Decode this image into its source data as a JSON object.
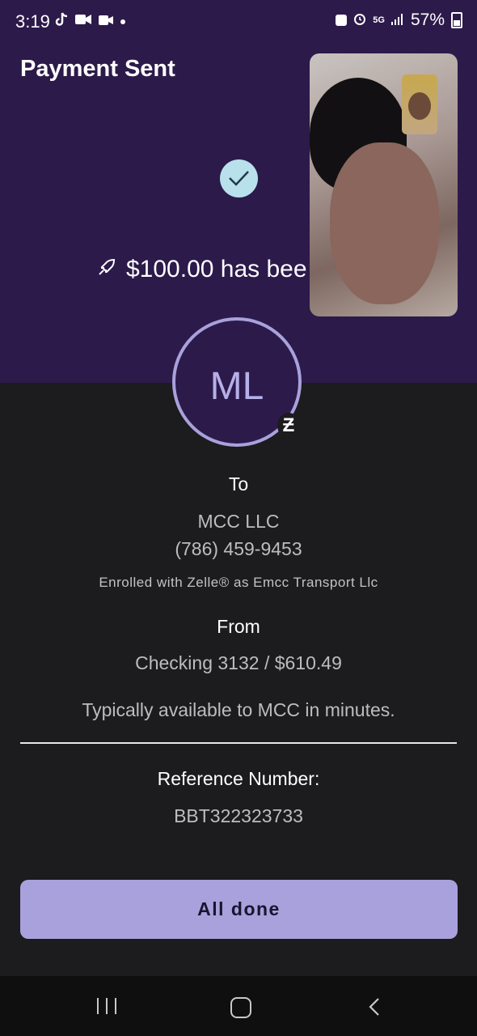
{
  "status_bar": {
    "time": "3:19",
    "battery": "57%",
    "network": "5G",
    "icons": [
      "tiktok-icon",
      "video-call-icon",
      "camera-icon",
      "dot-icon",
      "battery-saver-icon",
      "alarm-icon",
      "5g-icon",
      "signal-icon",
      "battery-icon"
    ]
  },
  "header": {
    "title": "Payment Sent"
  },
  "confirmation": {
    "icon": "check-icon",
    "amount_text": "$100.00 has bee"
  },
  "recipient": {
    "initials": "ML",
    "to_label": "To",
    "name": "MCC LLC",
    "phone": "(786) 459-9453",
    "enrolled_text": "Enrolled with Zelle® as Emcc Transport Llc"
  },
  "source": {
    "from_label": "From",
    "account": "Checking 3132 / $610.49",
    "availability": "Typically available to MCC in minutes."
  },
  "reference": {
    "label": "Reference Number:",
    "number": "BBT322323733"
  },
  "actions": {
    "done_label": "All done"
  },
  "colors": {
    "header_bg": "#2c1a4a",
    "body_bg": "#1c1b1d",
    "accent": "#a9a1dc",
    "check_bg": "#b9e1ec"
  }
}
